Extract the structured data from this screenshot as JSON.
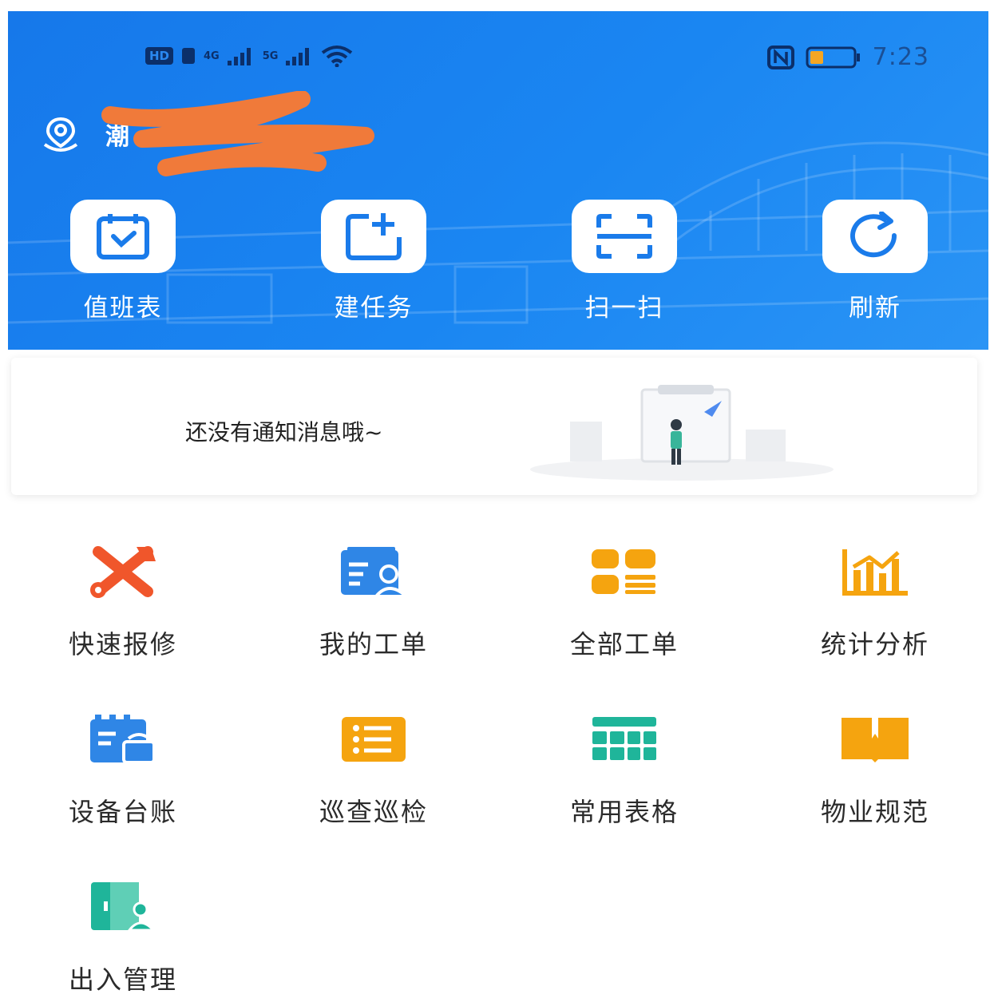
{
  "status_bar": {
    "hd_label": "HD",
    "signal_1": "4G",
    "signal_2": "5G",
    "time": "7:23"
  },
  "location": {
    "name": "潮"
  },
  "quick_actions": [
    {
      "label": "值班表",
      "icon": "calendar-check-icon"
    },
    {
      "label": "建任务",
      "icon": "add-task-icon"
    },
    {
      "label": "扫一扫",
      "icon": "scan-icon"
    },
    {
      "label": "刷新",
      "icon": "refresh-icon"
    }
  ],
  "notice": {
    "text": "还没有通知消息哦~"
  },
  "grid": [
    {
      "label": "快速报修",
      "icon": "wrench-icon",
      "color": "#f0562b"
    },
    {
      "label": "我的工单",
      "icon": "my-orders-icon",
      "color": "#2f86e6"
    },
    {
      "label": "全部工单",
      "icon": "all-orders-icon",
      "color": "#f5a40f"
    },
    {
      "label": "统计分析",
      "icon": "bar-chart-icon",
      "color": "#f5a40f"
    },
    {
      "label": "设备台账",
      "icon": "device-ledger-icon",
      "color": "#2f86e6"
    },
    {
      "label": "巡查巡检",
      "icon": "inspection-list-icon",
      "color": "#f5a40f"
    },
    {
      "label": "常用表格",
      "icon": "table-icon",
      "color": "#1fb59a"
    },
    {
      "label": "物业规范",
      "icon": "book-icon",
      "color": "#f5a40f"
    },
    {
      "label": "出入管理",
      "icon": "access-control-icon",
      "color": "#1fb59a"
    }
  ]
}
